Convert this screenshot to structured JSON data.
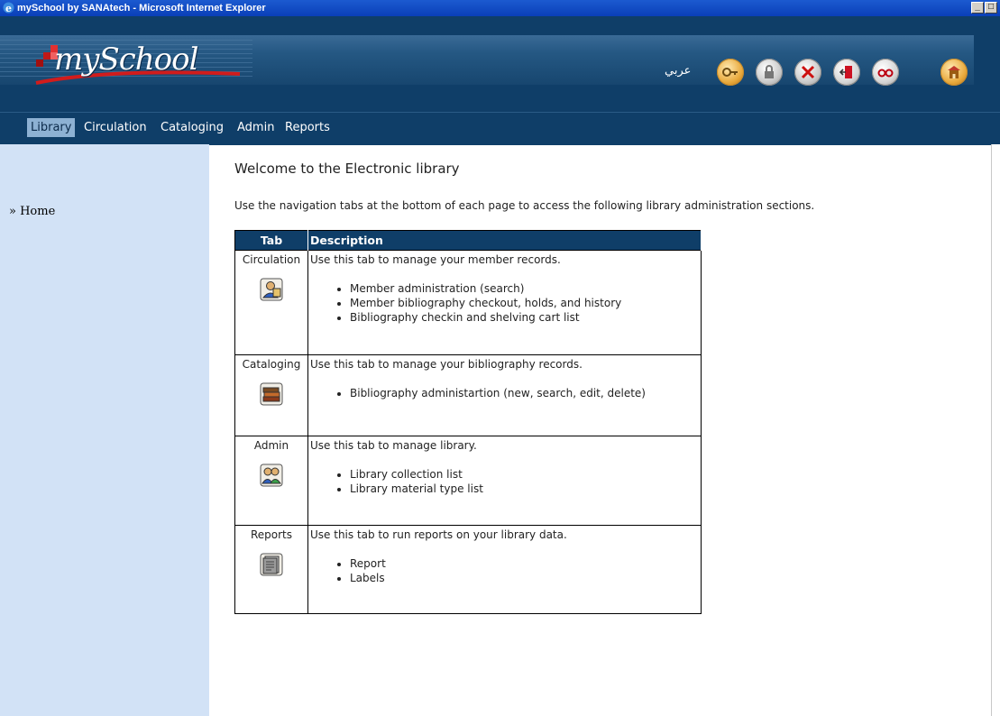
{
  "window": {
    "title": "mySchool by SANAtech - Microsoft Internet Explorer"
  },
  "header": {
    "logo_text": "mySchool",
    "language_link": "عربي",
    "icons": [
      "key-icon",
      "lock-icon",
      "cancel-icon",
      "exit-door-icon",
      "glasses-icon",
      "school-building-icon"
    ]
  },
  "nav": {
    "tabs": [
      {
        "label": "Library",
        "active": true
      },
      {
        "label": "Circulation",
        "active": false
      },
      {
        "label": "Cataloging",
        "active": false
      },
      {
        "label": "Admin",
        "active": false
      },
      {
        "label": "Reports",
        "active": false
      }
    ]
  },
  "sidebar": {
    "home_label": "» Home"
  },
  "main": {
    "title": "Welcome to the Electronic library",
    "intro": "Use the navigation tabs at the bottom of each page to access the following library administration sections.",
    "table": {
      "headers": [
        "Tab",
        "Description"
      ],
      "rows": [
        {
          "tab": "Circulation",
          "icon": "member-icon",
          "desc": "Use this tab to manage your member records.",
          "items": [
            "Member administration (search)",
            "Member bibliography checkout, holds, and history",
            "Bibliography checkin and shelving cart list"
          ]
        },
        {
          "tab": "Cataloging",
          "icon": "books-icon",
          "desc": "Use this tab to manage your bibliography records.",
          "items": [
            "Bibliography administartion (new, search, edit, delete)"
          ]
        },
        {
          "tab": "Admin",
          "icon": "users-icon",
          "desc": "Use this tab to manage library.",
          "items": [
            "Library collection list",
            "Library material type list"
          ]
        },
        {
          "tab": "Reports",
          "icon": "report-icon",
          "desc": "Use this tab to run reports on your library data.",
          "items": [
            "Report",
            "Labels"
          ]
        }
      ]
    }
  },
  "colors": {
    "header_bg": "#0f3e68",
    "sidebar_bg": "#d2e2f6",
    "active_tab_bg": "#8db1d3"
  }
}
